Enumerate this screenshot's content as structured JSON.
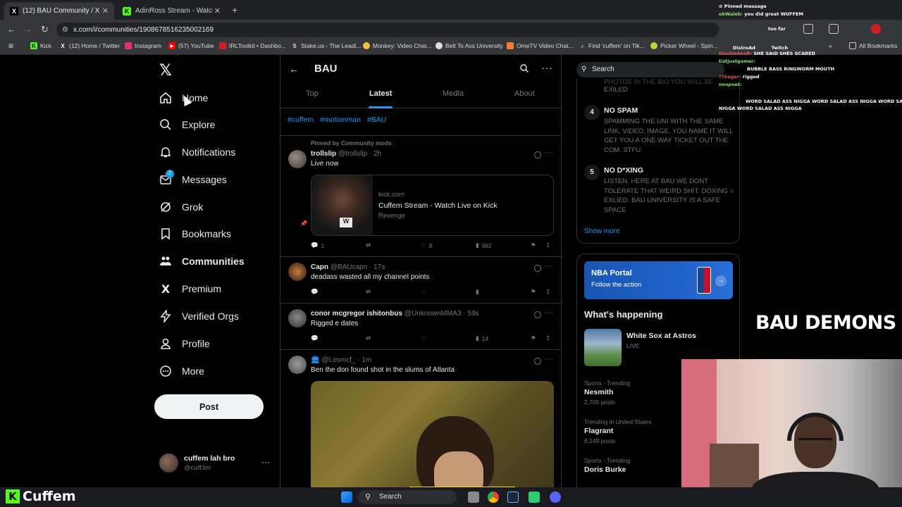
{
  "browser": {
    "tabs": [
      {
        "title": "(12) BAU Community / X",
        "favicon": "x-logo-icon"
      },
      {
        "title": "AdinRoss Stream - Watch Live o",
        "favicon": "kick-logo-icon"
      }
    ],
    "url": "x.com/i/communities/1908678516235002169",
    "bookmarks": [
      {
        "label": "Kick",
        "color": "#53fc18"
      },
      {
        "label": "(12) Home / Twitter",
        "color": "#ffffff"
      },
      {
        "label": "Instagram",
        "color": "#e1306c"
      },
      {
        "label": "(57) YouTube",
        "color": "#ff0000"
      },
      {
        "label": "IRLToolkit • Dashbo...",
        "color": "#cc2222"
      },
      {
        "label": "Stake.us - The Leadi...",
        "color": "#dddddd"
      },
      {
        "label": "Monkey: Video Chat...",
        "color": "#f0c040"
      },
      {
        "label": "Belt To Ass University",
        "color": "#dddddd"
      },
      {
        "label": "OmeTV Video Chat...",
        "color": "#f08030"
      },
      {
        "label": "Find 'cuffem' on Tik...",
        "color": "#ffffff"
      },
      {
        "label": "Picker Wheel - Spin...",
        "color": "#c0d040"
      }
    ],
    "all_bookmarks": "All Bookmarks"
  },
  "nav": {
    "items": [
      {
        "label": "Home",
        "icon": "home-icon"
      },
      {
        "label": "Explore",
        "icon": "search-icon"
      },
      {
        "label": "Notifications",
        "icon": "bell-icon"
      },
      {
        "label": "Messages",
        "icon": "envelope-icon",
        "badge": "2"
      },
      {
        "label": "Grok",
        "icon": "grok-icon"
      },
      {
        "label": "Bookmarks",
        "icon": "bookmark-icon"
      },
      {
        "label": "Communities",
        "icon": "communities-icon"
      },
      {
        "label": "Premium",
        "icon": "x-logo-icon"
      },
      {
        "label": "Verified Orgs",
        "icon": "lightning-icon"
      },
      {
        "label": "Profile",
        "icon": "person-icon"
      },
      {
        "label": "More",
        "icon": "more-circle-icon"
      }
    ],
    "post_label": "Post",
    "account": {
      "name": "cuffem lah bro",
      "handle": "@cuff3m"
    }
  },
  "community": {
    "name": "BAU",
    "tabs": [
      "Top",
      "Latest",
      "Media",
      "About"
    ],
    "active_tab": "Latest",
    "hashtags": [
      "#cuffem",
      "#motionman",
      "#BAU"
    ],
    "pinned_label": "Pinned by Community mods"
  },
  "tweets": [
    {
      "name": "trollslip",
      "handle": "@trollslip",
      "time": "· 2h",
      "text": "Live now",
      "card": {
        "domain": "kick.com",
        "title": "Cuffem Stream - Watch Live on Kick",
        "subtitle": "Revenge"
      },
      "replies": "1",
      "reposts": "",
      "likes": "8",
      "views": "682"
    },
    {
      "name": "Capn",
      "handle": "@BAUcapn",
      "time": "· 17s",
      "text": "deadass wasted all my channel points",
      "replies": "",
      "reposts": "",
      "likes": "",
      "views": ""
    },
    {
      "name": "conor mcgregor ishitonbus",
      "handle": "@UnknownMMA3",
      "time": "· 59s",
      "text": "Rigged e dates",
      "replies": "",
      "reposts": "",
      "likes": "",
      "views": "14"
    },
    {
      "name": "",
      "handle": "@Losmcf_",
      "time": "· 1m",
      "text": "Ben the don found shot in the slums of Atlanta"
    }
  ],
  "right": {
    "search_placeholder": "Search",
    "rule_top_fragment": "EXILED",
    "rule_top_fragment_faded": "PHOTOS IN THE BIO YOU WILL BE",
    "rules": [
      {
        "num": "4",
        "title": "NO SPAM",
        "text": "SPAMMING THE UNI WITH THE SAME LINK, VIDEO, IMAGE, YOU NAME IT WILL GET YOU A ONE WAY TICKET OUT THE COM. STFU."
      },
      {
        "num": "5",
        "title": "NO D*XING",
        "text": "LISTEN. HERE AT BAU WE DONT TOLERATE THAT WEIRD SHIT. DOXING = EXLIED. BAU UNIVERSITY IS A SAFE SPACE"
      }
    ],
    "show_more": "Show more",
    "nba": {
      "title": "NBA Portal",
      "subtitle": "Follow the action"
    },
    "whats_happening": "What's happening",
    "live_event": {
      "title": "White Sox at Astros",
      "status": "LIVE"
    },
    "trends": [
      {
        "category": "Sports · Trending",
        "name": "Nesmith",
        "count": "2,706 posts"
      },
      {
        "category": "Trending in United States",
        "name": "Flagrant",
        "count": "6,149 posts"
      },
      {
        "category": "Sports · Trending",
        "name": "Doris Burke",
        "count": ""
      }
    ]
  },
  "overlay": {
    "chat": [
      {
        "user": "",
        "msg": "Pinned message"
      },
      {
        "user": "okWaleb:",
        "msg": "you did great WUFFEM"
      },
      {
        "user": "",
        "msg": "too far"
      },
      {
        "user": "DistroAd",
        "msg": "Twitch"
      },
      {
        "user": "DoubleAeeR:",
        "msg": "SHE SAID SHES SCARED"
      },
      {
        "user": "tiztjustgamer:",
        "msg": ""
      },
      {
        "user": "",
        "msg": "BUBBLE BASS RINGWORM MOUTH"
      },
      {
        "user": "??Seger:",
        "msg": "rigged"
      },
      {
        "user": "noopoet:",
        "msg": ""
      },
      {
        "user": "",
        "msg": "WORD SALAD ASS NIGGA WORD SALAD ASS NIGGA WORD SALAD ASS"
      },
      {
        "user": "",
        "msg": "NIGGA WORD SALAD ASS NIGGA"
      }
    ],
    "banner": "BAU DEMONS",
    "streamer_logo_text": "Cuffem"
  },
  "taskbar": {
    "search_label": "Search"
  }
}
